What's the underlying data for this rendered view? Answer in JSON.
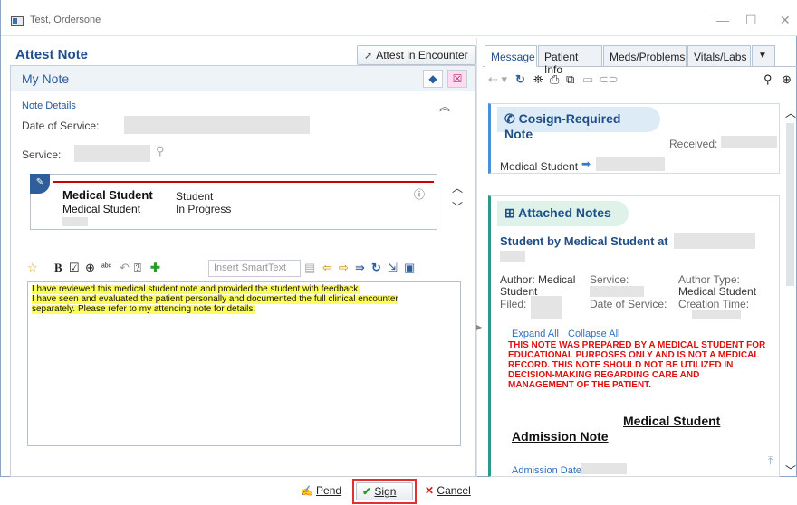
{
  "window": {
    "title": "Test, Ordersone"
  },
  "left": {
    "header": "Attest Note",
    "attest_button": "Attest in Encounter",
    "my_note": "My Note",
    "note_details": "Note Details",
    "date_of_service_label": "Date of Service:",
    "service_label": "Service:",
    "student": {
      "name_bold": "Medical Student",
      "name": "Medical Student",
      "role": "Student",
      "status": "In Progress"
    },
    "insert_smarttext": "Insert SmartText",
    "note_lines": [
      "I have reviewed this medical student note and provided the student with feedback.",
      "I have seen and evaluated the patient personally and documented the full clinical encounter",
      "separately.  Please refer to my attending note for details."
    ],
    "buttons": {
      "pend": "Pend",
      "sign": "Sign",
      "cancel": "Cancel"
    }
  },
  "right": {
    "tabs": [
      "Message",
      "Patient Info",
      "Meds/Problems",
      "Vitals/Labs"
    ],
    "cosign_title": "Cosign-Required Note",
    "received_label": "Received:",
    "from_label": "Medical Student",
    "attached_title": "Attached Notes",
    "student_by": "Student by Medical Student at",
    "author_label": "Author: Medical",
    "author_label2": "Student",
    "service_label": "Service:",
    "author_type_label": "Author Type:",
    "author_type_value": "Medical Student",
    "filed_label": "Filed:",
    "dos_label": "Date of Service:",
    "creation_label": "Creation Time:",
    "expand_all": "Expand All",
    "collapse_all": "Collapse All",
    "warning": "THIS NOTE WAS PREPARED BY A MEDICAL STUDENT FOR EDUCATIONAL PURPOSES ONLY AND IS NOT A MEDICAL RECORD. THIS NOTE SHOULD NOT BE UTILIZED IN DECISION-MAKING REGARDING CARE AND MANAGEMENT OF THE PATIENT.",
    "heading1": "Medical Student",
    "heading2": "Admission Note",
    "admission_date": "Admission Date:"
  },
  "colors": {
    "accent": "#1f4e8a",
    "highlight": "#ffff5a",
    "warning": "#e01010",
    "sign_outline": "#e03030"
  }
}
